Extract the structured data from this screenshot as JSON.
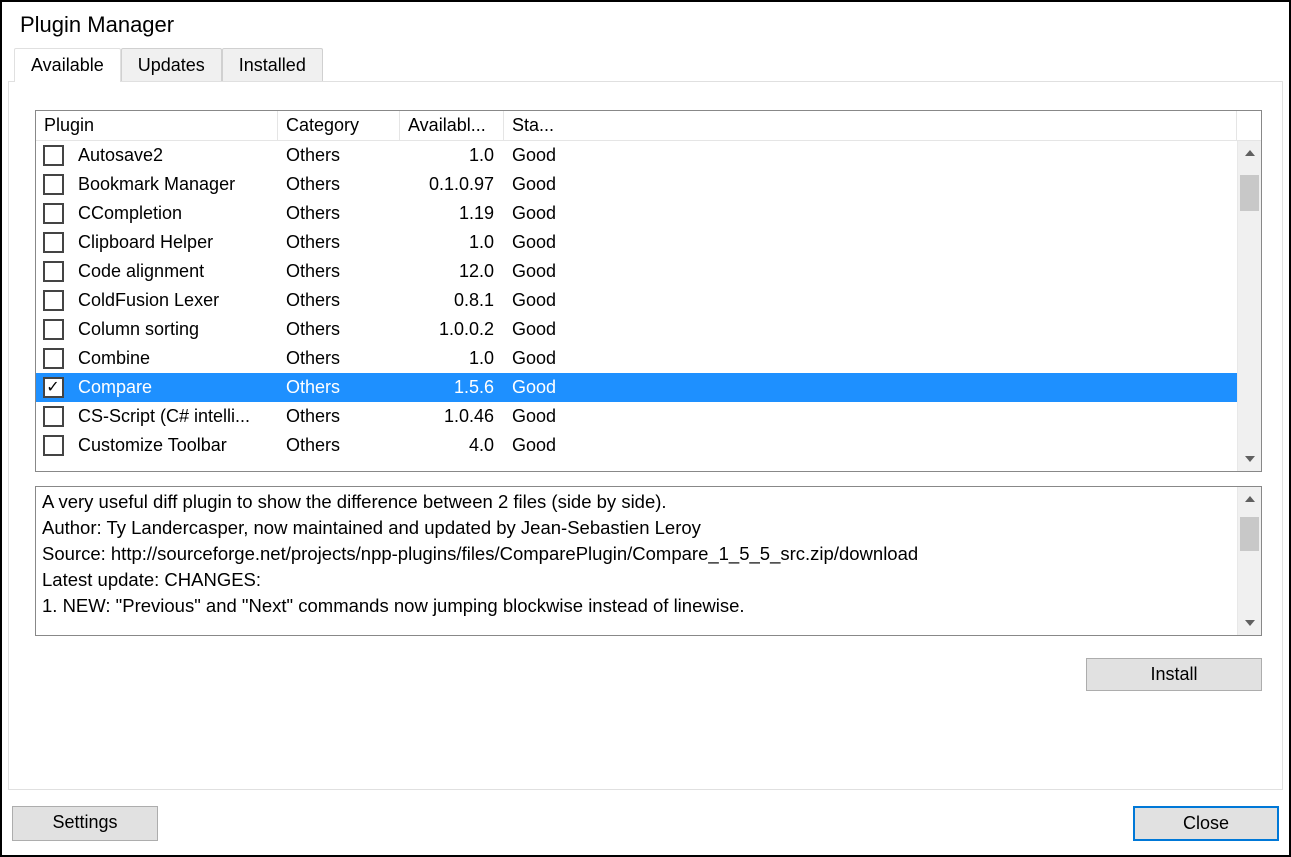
{
  "title": "Plugin Manager",
  "tabs": {
    "available": "Available",
    "updates": "Updates",
    "installed": "Installed"
  },
  "headers": {
    "plugin": "Plugin",
    "category": "Category",
    "available": "Availabl...",
    "stability": "Sta..."
  },
  "plugins": [
    {
      "name": "Autosave2",
      "category": "Others",
      "version": "1.0",
      "stability": "Good",
      "checked": false,
      "selected": false
    },
    {
      "name": "Bookmark Manager",
      "category": "Others",
      "version": "0.1.0.97",
      "stability": "Good",
      "checked": false,
      "selected": false
    },
    {
      "name": "CCompletion",
      "category": "Others",
      "version": "1.19",
      "stability": "Good",
      "checked": false,
      "selected": false
    },
    {
      "name": "Clipboard Helper",
      "category": "Others",
      "version": "1.0",
      "stability": "Good",
      "checked": false,
      "selected": false
    },
    {
      "name": "Code alignment",
      "category": "Others",
      "version": "12.0",
      "stability": "Good",
      "checked": false,
      "selected": false
    },
    {
      "name": "ColdFusion Lexer",
      "category": "Others",
      "version": "0.8.1",
      "stability": "Good",
      "checked": false,
      "selected": false
    },
    {
      "name": "Column sorting",
      "category": "Others",
      "version": "1.0.0.2",
      "stability": "Good",
      "checked": false,
      "selected": false
    },
    {
      "name": "Combine",
      "category": "Others",
      "version": "1.0",
      "stability": "Good",
      "checked": false,
      "selected": false
    },
    {
      "name": "Compare",
      "category": "Others",
      "version": "1.5.6",
      "stability": "Good",
      "checked": true,
      "selected": true
    },
    {
      "name": "CS-Script (C# intelli...",
      "category": "Others",
      "version": "1.0.46",
      "stability": "Good",
      "checked": false,
      "selected": false
    },
    {
      "name": "Customize Toolbar",
      "category": "Others",
      "version": "4.0",
      "stability": "Good",
      "checked": false,
      "selected": false
    }
  ],
  "description": "A very useful diff plugin to show the difference between 2 files (side by side).\nAuthor: Ty Landercasper, now maintained and updated by Jean-Sebastien Leroy\nSource: http://sourceforge.net/projects/npp-plugins/files/ComparePlugin/Compare_1_5_5_src.zip/download\nLatest update: CHANGES:\n1. NEW: \"Previous\" and \"Next\" commands now jumping blockwise instead of linewise.",
  "buttons": {
    "install": "Install",
    "settings": "Settings",
    "close": "Close"
  }
}
